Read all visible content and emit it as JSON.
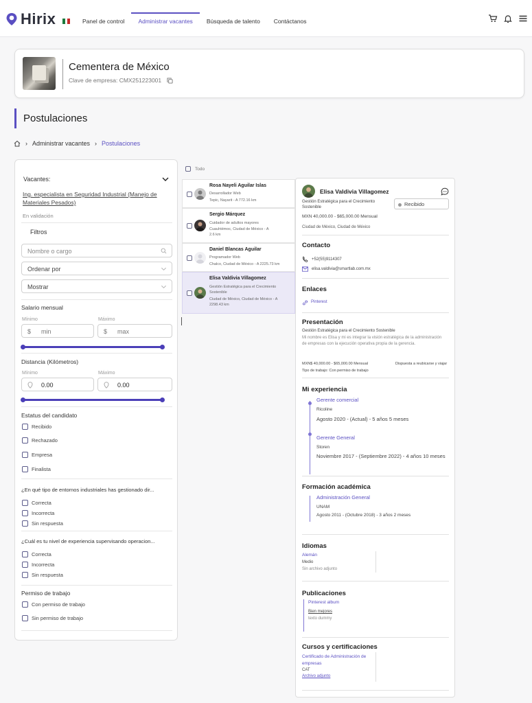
{
  "nav": {
    "brand": "Hirix",
    "links": [
      "Panel de control",
      "Administrar vacantes",
      "Búsqueda de talento",
      "Contáctanos"
    ],
    "active_index": 1,
    "accent_color": "#5a4fc2"
  },
  "company": {
    "name": "Cementera de México",
    "key_label": "Clave de empresa: CMX251223001"
  },
  "page": {
    "title": "Postulaciones",
    "breadcrumb": [
      "Administrar vacantes",
      "Postulaciones"
    ]
  },
  "filters": {
    "vacantes_label": "Vacantes:",
    "vacancy_value": "Ing. especialista en Seguridad Industrial (Manejo de Materiales Pesados)",
    "vacancy_status": "En validación",
    "filtros_label": "Filtros",
    "search_placeholder": "Nombre o cargo",
    "order_label": "Ordenar por",
    "show_label": "Mostrar",
    "salary": {
      "title": "Salario mensual",
      "min_label": "Mínimo",
      "max_label": "Máximo",
      "currency": "$",
      "min_placeholder": "min",
      "max_placeholder": "max"
    },
    "distance": {
      "title": "Distancia (Kilómetros)",
      "min_label": "Mínimo",
      "max_label": "Máximo",
      "min_value": "0.00",
      "max_value": "0.00"
    },
    "status": {
      "title": "Estatus del candidato",
      "options": [
        "Recibido",
        "Rechazado",
        "Empresa",
        "Finalista"
      ]
    },
    "question1": {
      "title": "¿En qué tipo de entornos industriales has gestionado dir...",
      "options": [
        "Correcta",
        "Incorrecta",
        "Sin respuesta"
      ]
    },
    "question2": {
      "title": "¿Cuál es tu nivel de experiencia supervisando operacion...",
      "options": [
        "Correcta",
        "Incorrecta",
        "Sin respuesta"
      ]
    },
    "permit": {
      "title": "Permiso de trabajo",
      "options": [
        "Con permiso de trabajo",
        "Sin permiso de trabajo"
      ]
    }
  },
  "list": {
    "select_all": "Todo",
    "candidates": [
      {
        "name": "Rosa Nayeli Aguilar Islas",
        "line1": "Desarrollador Web",
        "line2": "Tepic, Nayarit - A 772.16 km"
      },
      {
        "name": "Sergio Márquez",
        "line1": "Cuidador de adultos mayores",
        "line2": "Cuauhtémoc, Ciudad de México - A",
        "line3": "2.6 km"
      },
      {
        "name": "Daniel Blancas Aguilar",
        "line1": "Programador Web",
        "line2": "Chalco, Ciudad de México - A 2225.73 km"
      },
      {
        "name": "Elisa Valdivia Villagomez",
        "line1": "Gestión Estratégica para el Crecimiento",
        "line2": "Sostenible",
        "line3": "Ciudad de México, Ciudad de México - A",
        "line4": "2298.43 km"
      }
    ],
    "selected_index": 3
  },
  "detail": {
    "name": "Elisa Valdivia Villagomez",
    "headline": "Gestión Estratégica para el Crecimiento Sostenible",
    "salary": "MXN 40,000.00 - $65,000.00 Mensual",
    "location": "Ciudad de México, Ciudad de México",
    "status": "Recibido",
    "contact": {
      "title": "Contacto",
      "phone": "+52(55)9114307",
      "email": "elisa.valdivia@smartlab.com.mx"
    },
    "links": {
      "title": "Enlaces",
      "items": [
        "Pinterest"
      ]
    },
    "presentation": {
      "title": "Presentación",
      "subtitle": "Gestión Estratégica para el Crecimiento Sostenible",
      "text": "Mi nombre es Elisa y mi es integrar la visión estratégica de la administración de empresas con la ejecución operativa propia de la gerencia.",
      "salary": "MXN$ 40,000.00 - $65,000.00 Mensual",
      "relocation": "Dispuesta a reubicarse y viajar",
      "job_type": "Tipo de trabajo: Con permiso de trabajo"
    },
    "experience": {
      "title": "Mi experiencia",
      "items": [
        {
          "role": "Gerente comercial",
          "company": "Ricoline",
          "period": "Agosto 2020 - (Actual) - 5 años 5 meses"
        },
        {
          "role": "Gerente General",
          "company": "Storen",
          "period": "Noviembre 2017 - (Septiembre 2022) - 4 años 10 meses"
        }
      ]
    },
    "education": {
      "title": "Formación académica",
      "degree": "Administración General",
      "school": "UNAM",
      "period": "Agosto 2011 - (Octubre 2018) - 3 años 2 meses"
    },
    "languages": {
      "title": "Idiomas",
      "language": "Alemán",
      "level": "Medio",
      "note": "Sin archivo adjunto"
    },
    "publications": {
      "title": "Publicaciones",
      "name": "Pinterest album",
      "sub": "Bien mejores",
      "desc": "texto dummy"
    },
    "courses": {
      "title": "Cursos y certificaciones",
      "name": "Certificado de Administración de empresas",
      "issuer": "CAT",
      "attachment": "Archivo adjunto"
    }
  }
}
